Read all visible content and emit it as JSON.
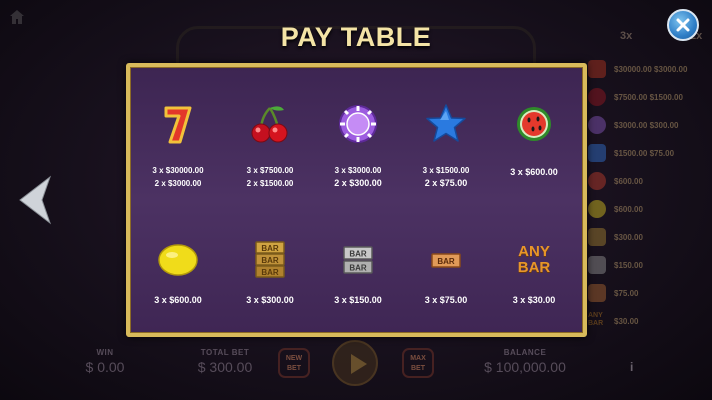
{
  "title": "PAY TABLE",
  "colors": {
    "accent": "#d8ba5b",
    "panel": "#45295b",
    "title": "#f4e4a6"
  },
  "symbols": [
    {
      "name": "seven-icon",
      "pays": [
        "3 x $30000.00",
        "2 x $3000.00"
      ]
    },
    {
      "name": "cherry-icon",
      "pays": [
        "3 x $7500.00",
        "2 x $1500.00"
      ]
    },
    {
      "name": "chip-icon",
      "pays": [
        "3 x $3000.00",
        "2 x $300.00"
      ]
    },
    {
      "name": "star-icon",
      "pays": [
        "3 x $1500.00",
        "2 x $75.00"
      ]
    },
    {
      "name": "watermelon-icon",
      "pays": [
        "3 x $600.00"
      ]
    },
    {
      "name": "lemon-icon",
      "pays": [
        "3 x $600.00"
      ]
    },
    {
      "name": "triple-bar-icon",
      "pays": [
        "3 x $300.00"
      ]
    },
    {
      "name": "double-bar-icon",
      "pays": [
        "3 x $150.00"
      ]
    },
    {
      "name": "single-bar-icon",
      "pays": [
        "3 x $75.00"
      ]
    },
    {
      "name": "any-bar-icon",
      "text": "ANY BAR",
      "pays": [
        "3 x $30.00"
      ]
    }
  ],
  "background": {
    "header": [
      "3x",
      "2x"
    ],
    "side_values": [
      "$30000.00  $3000.00",
      "$7500.00  $1500.00",
      "$3000.00  $300.00",
      "$1500.00  $75.00",
      "$600.00",
      "$600.00",
      "$300.00",
      "$150.00",
      "$75.00",
      "$30.00"
    ],
    "bar_text": "BAR",
    "any_label": "ANY",
    "win_label": "WIN",
    "win_value": "$ 0.00",
    "total_bet_label": "TOTAL BET",
    "total_bet_value": "$ 300.00",
    "new_bet": "NEW BET",
    "max_bet": "MAX BET",
    "balance_label": "BALANCE",
    "balance_value": "$ 100,000.00",
    "info": "i"
  }
}
